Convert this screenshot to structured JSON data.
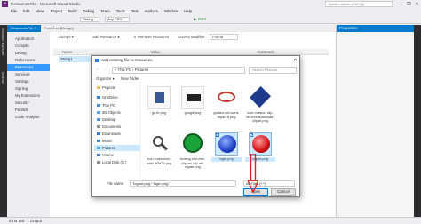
{
  "window": {
    "title": "ResourcesFile - Microsoft Visual Studio",
    "quick_launch_placeholder": "Quick Launch (Ctrl+Q)",
    "logo_glyph": "∞",
    "controls": [
      "—",
      "❐",
      "✕"
    ]
  },
  "menu": [
    "File",
    "Edit",
    "View",
    "Project",
    "Build",
    "Debug",
    "Team",
    "Tools",
    "Test",
    "Analyze",
    "Window",
    "Help"
  ],
  "toolbar": {
    "config": "Debug",
    "platform": "Any CPU",
    "start_label": "▶ Start"
  },
  "left_strip": [
    "Solution Explorer",
    "Toolbox"
  ],
  "doc_tabs": [
    {
      "label": "ResourcesFile ✕",
      "active": true
    },
    {
      "label": "Form1.cs [Design]",
      "active": false
    }
  ],
  "properties_panel": {
    "title": "Properties"
  },
  "project_nav": [
    "Application",
    "Compile",
    "Debug",
    "References",
    "Resources",
    "Services",
    "Settings",
    "Signing",
    "My Extensions",
    "Security",
    "Publish",
    "Code Analysis"
  ],
  "project_nav_selected": 4,
  "resource_toolbar": {
    "strings": "Strings ▾",
    "add_resource": "Add Resource ▾",
    "remove_resource": "✕ Remove Resource",
    "access_modifier_label": "Access Modifier:",
    "access_modifier_value": "Friend"
  },
  "grid_columns": [
    "Name",
    "Value",
    "Comment"
  ],
  "grid_first_cell": "String1",
  "dialog": {
    "title": "Add existing file to resources",
    "close": "✕",
    "path": "›  This PC  ›  Pictures",
    "search_placeholder": "Search Pictures",
    "organize": "Organize ▾",
    "new_folder": "New folder",
    "tree": [
      "Projects",
      "OneDrive",
      "This PC",
      "3D Objects",
      "Desktop",
      "Documents",
      "Downloads",
      "Music",
      "Pictures",
      "Videos",
      "Local Disk (C:)"
    ],
    "tree_selected": 8,
    "files": [
      {
        "name": "gif-fb.png",
        "selected": false,
        "thumb": "#3b5998"
      },
      {
        "name": "google.png",
        "selected": false,
        "thumb": "#222"
      },
      {
        "name": "grades-set-icons-clipart-8.png",
        "selected": false,
        "thumb": "#c0392b"
      },
      {
        "name": "icon-mission-clip-art-free-download-clipart.png",
        "selected": false,
        "thumb": "#1e3a8a"
      },
      {
        "name": "icon-curriculum-wide-4f3e29.png",
        "selected": false,
        "thumb": "#444"
      },
      {
        "name": "icoxmg-rest-free-clip-art-clip-art-clipart.png",
        "selected": false,
        "thumb": "#1aa33b"
      },
      {
        "name": "login.png",
        "selected": true,
        "thumb": "#1e40c8"
      },
      {
        "name": "logout.png",
        "selected": true,
        "thumb": "#d01010"
      }
    ],
    "file_name_label": "File name:",
    "file_name_value": "\"logout.png\" \"login.png\"",
    "file_type_value": "All Files (*.*)",
    "open": "Open",
    "cancel": "Cancel"
  },
  "status_bar": [
    "Error List",
    "Output"
  ],
  "colors": {
    "accent": "#007acc",
    "selection": "#3399ff",
    "arrow": "#e02020"
  }
}
